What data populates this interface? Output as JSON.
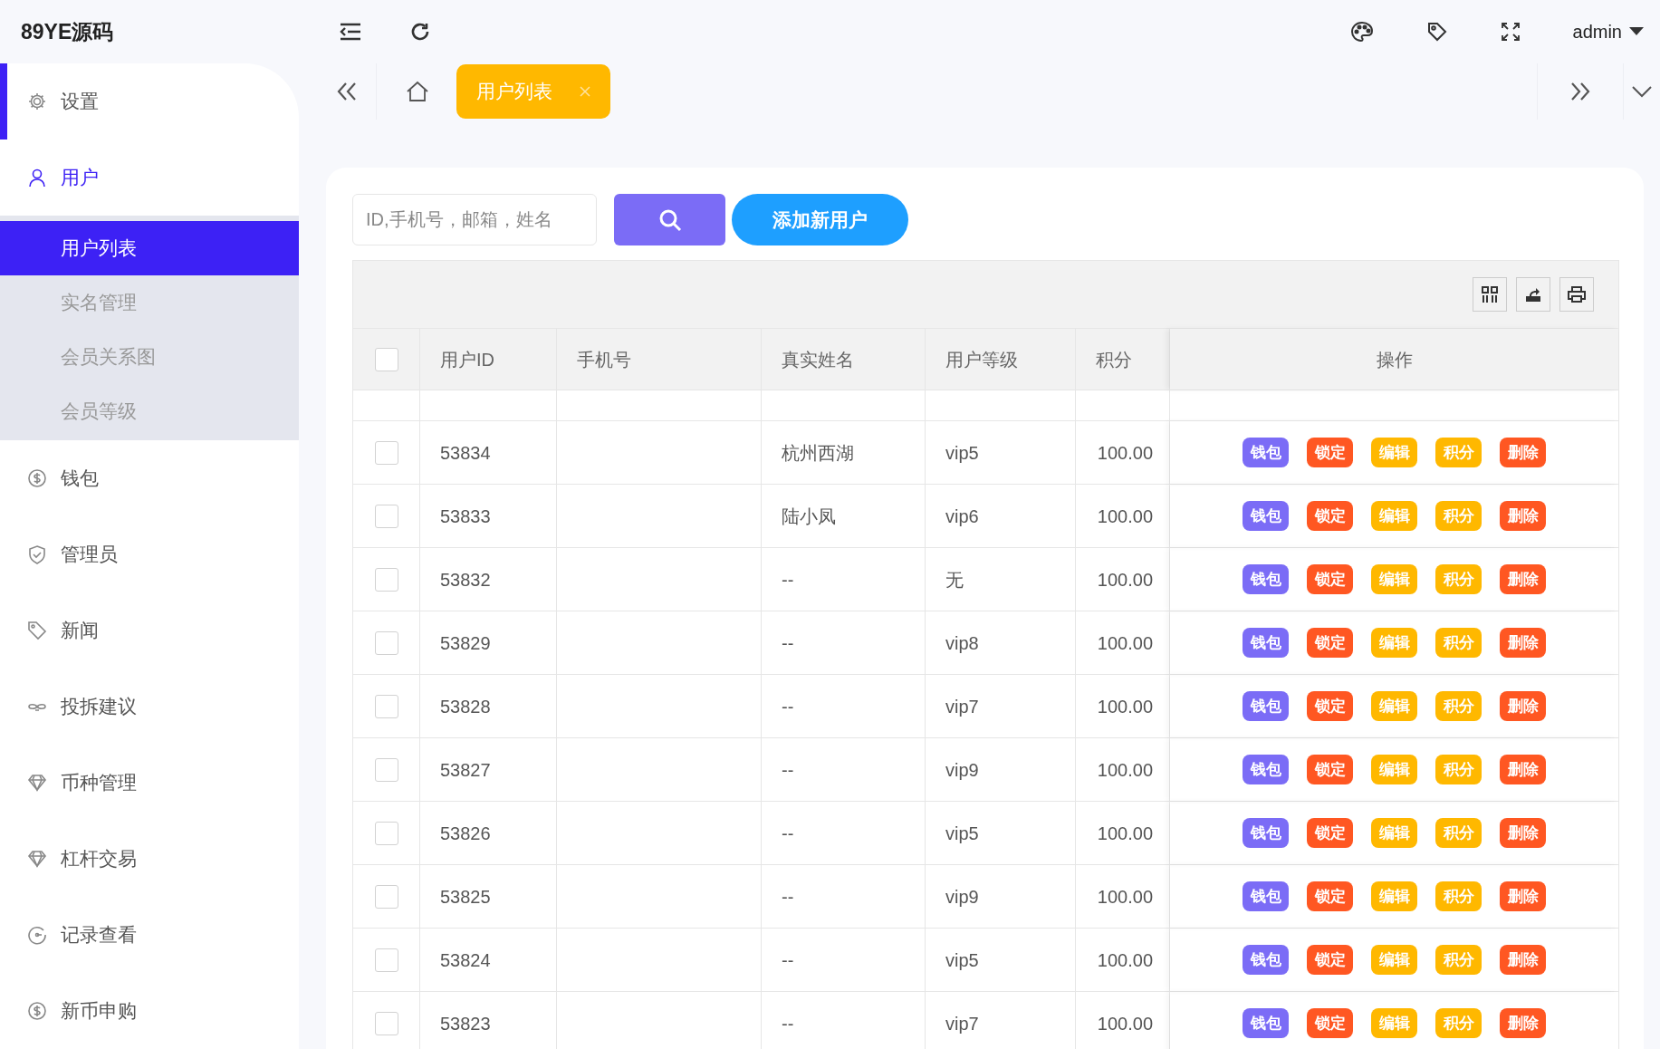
{
  "brand": "89YE源码",
  "header": {
    "user": "admin"
  },
  "sidebar": {
    "items": [
      {
        "label": "设置",
        "indicator": true,
        "expanded": false
      },
      {
        "label": "用户",
        "indicator": false,
        "expanded": true,
        "children": [
          {
            "label": "用户列表",
            "selected": true
          },
          {
            "label": "实名管理",
            "selected": false
          },
          {
            "label": "会员关系图",
            "selected": false
          },
          {
            "label": "会员等级",
            "selected": false
          }
        ]
      },
      {
        "label": "钱包",
        "indicator": false,
        "expanded": false
      },
      {
        "label": "管理员",
        "indicator": false,
        "expanded": false
      },
      {
        "label": "新闻",
        "indicator": false,
        "expanded": false
      },
      {
        "label": "投拆建议",
        "indicator": false,
        "expanded": false
      },
      {
        "label": "币种管理",
        "indicator": false,
        "expanded": false
      },
      {
        "label": "杠杆交易",
        "indicator": false,
        "expanded": false
      },
      {
        "label": "记录查看",
        "indicator": false,
        "expanded": false
      },
      {
        "label": "新币申购",
        "indicator": false,
        "expanded": false
      }
    ]
  },
  "tabs": [
    {
      "label": "用户列表",
      "selected": true
    }
  ],
  "search": {
    "placeholder": "ID,手机号，邮箱，姓名"
  },
  "add_button": "添加新用户",
  "table": {
    "select_all": false,
    "columns": [
      "用户ID",
      "手机号",
      "真实姓名",
      "用户等级",
      "积分",
      "操作"
    ],
    "rows": [
      {
        "checked": false,
        "id": "53834",
        "name": "杭州西湖",
        "level": "vip5",
        "points": "100.00",
        "actions": [
          {
            "label": "钱包",
            "color": "#7b6cf6"
          },
          {
            "label": "锁定",
            "color": "#ff5722"
          },
          {
            "label": "编辑",
            "color": "#ffb800"
          },
          {
            "label": "积分",
            "color": "#ffb800"
          },
          {
            "label": "删除",
            "color": "#ff5722"
          }
        ]
      },
      {
        "checked": false,
        "id": "53833",
        "name": "陆小凤",
        "level": "vip6",
        "points": "100.00",
        "actions": [
          {
            "label": "钱包",
            "color": "#7b6cf6"
          },
          {
            "label": "锁定",
            "color": "#ff5722"
          },
          {
            "label": "编辑",
            "color": "#ffb800"
          },
          {
            "label": "积分",
            "color": "#ffb800"
          },
          {
            "label": "删除",
            "color": "#ff5722"
          }
        ]
      },
      {
        "checked": false,
        "id": "53832",
        "name": "--",
        "level": "无",
        "points": "100.00",
        "actions": [
          {
            "label": "钱包",
            "color": "#7b6cf6"
          },
          {
            "label": "锁定",
            "color": "#ff5722"
          },
          {
            "label": "编辑",
            "color": "#ffb800"
          },
          {
            "label": "积分",
            "color": "#ffb800"
          },
          {
            "label": "删除",
            "color": "#ff5722"
          }
        ]
      },
      {
        "checked": false,
        "id": "53829",
        "name": "--",
        "level": "vip8",
        "points": "100.00",
        "actions": [
          {
            "label": "钱包",
            "color": "#7b6cf6"
          },
          {
            "label": "锁定",
            "color": "#ff5722"
          },
          {
            "label": "编辑",
            "color": "#ffb800"
          },
          {
            "label": "积分",
            "color": "#ffb800"
          },
          {
            "label": "删除",
            "color": "#ff5722"
          }
        ]
      },
      {
        "checked": false,
        "id": "53828",
        "name": "--",
        "level": "vip7",
        "points": "100.00",
        "actions": [
          {
            "label": "钱包",
            "color": "#7b6cf6"
          },
          {
            "label": "锁定",
            "color": "#ff5722"
          },
          {
            "label": "编辑",
            "color": "#ffb800"
          },
          {
            "label": "积分",
            "color": "#ffb800"
          },
          {
            "label": "删除",
            "color": "#ff5722"
          }
        ]
      },
      {
        "checked": false,
        "id": "53827",
        "name": "--",
        "level": "vip9",
        "points": "100.00",
        "actions": [
          {
            "label": "钱包",
            "color": "#7b6cf6"
          },
          {
            "label": "锁定",
            "color": "#ff5722"
          },
          {
            "label": "编辑",
            "color": "#ffb800"
          },
          {
            "label": "积分",
            "color": "#ffb800"
          },
          {
            "label": "删除",
            "color": "#ff5722"
          }
        ]
      },
      {
        "checked": false,
        "id": "53826",
        "name": "--",
        "level": "vip5",
        "points": "100.00",
        "actions": [
          {
            "label": "钱包",
            "color": "#7b6cf6"
          },
          {
            "label": "锁定",
            "color": "#ff5722"
          },
          {
            "label": "编辑",
            "color": "#ffb800"
          },
          {
            "label": "积分",
            "color": "#ffb800"
          },
          {
            "label": "删除",
            "color": "#ff5722"
          }
        ]
      },
      {
        "checked": false,
        "id": "53825",
        "name": "--",
        "level": "vip9",
        "points": "100.00",
        "actions": [
          {
            "label": "钱包",
            "color": "#7b6cf6"
          },
          {
            "label": "锁定",
            "color": "#ff5722"
          },
          {
            "label": "编辑",
            "color": "#ffb800"
          },
          {
            "label": "积分",
            "color": "#ffb800"
          },
          {
            "label": "删除",
            "color": "#ff5722"
          }
        ]
      },
      {
        "checked": false,
        "id": "53824",
        "name": "--",
        "level": "vip5",
        "points": "100.00",
        "actions": [
          {
            "label": "钱包",
            "color": "#7b6cf6"
          },
          {
            "label": "锁定",
            "color": "#ff5722"
          },
          {
            "label": "编辑",
            "color": "#ffb800"
          },
          {
            "label": "积分",
            "color": "#ffb800"
          },
          {
            "label": "删除",
            "color": "#ff5722"
          }
        ]
      },
      {
        "checked": false,
        "id": "53823",
        "name": "--",
        "level": "vip7",
        "points": "100.00",
        "actions": [
          {
            "label": "钱包",
            "color": "#7b6cf6"
          },
          {
            "label": "锁定",
            "color": "#ff5722"
          },
          {
            "label": "编辑",
            "color": "#ffb800"
          },
          {
            "label": "积分",
            "color": "#ffb800"
          },
          {
            "label": "删除",
            "color": "#ff5722"
          }
        ]
      }
    ]
  }
}
